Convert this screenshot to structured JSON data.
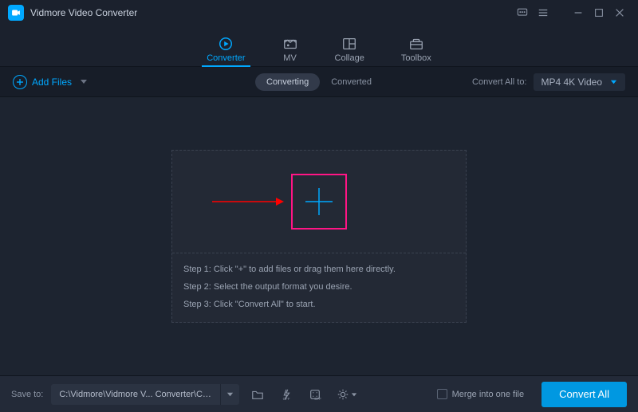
{
  "titlebar": {
    "app_title": "Vidmore Video Converter"
  },
  "nav": {
    "converter": "Converter",
    "mv": "MV",
    "collage": "Collage",
    "toolbox": "Toolbox"
  },
  "secbar": {
    "add_files": "Add Files",
    "converting": "Converting",
    "converted": "Converted",
    "convert_all_to": "Convert All to:",
    "format": "MP4 4K Video"
  },
  "dropzone": {
    "step1": "Step 1: Click \"+\" to add files or drag them here directly.",
    "step2": "Step 2: Select the output format you desire.",
    "step3": "Step 3: Click \"Convert All\" to start."
  },
  "footer": {
    "save_to": "Save to:",
    "path": "C:\\Vidmore\\Vidmore V... Converter\\Converted",
    "merge": "Merge into one file",
    "convert_all": "Convert All"
  }
}
